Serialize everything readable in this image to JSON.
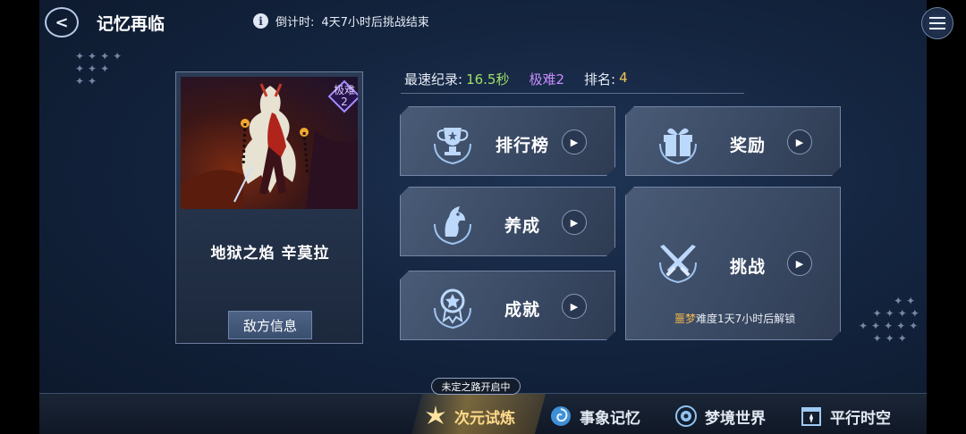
{
  "header": {
    "title": "记忆再临",
    "countdown_label": "倒计时:",
    "countdown_text": "4天7小时后挑战结束"
  },
  "boss": {
    "name": "地狱之焰 辛莫拉",
    "difficulty_badge_top": "极难",
    "difficulty_badge_bottom": "2",
    "enemy_info_label": "敌方信息"
  },
  "record": {
    "best_label": "最速纪录:",
    "best_time": "16.5秒",
    "difficulty": "极难2",
    "rank_label": "排名:",
    "rank_value": "4"
  },
  "actions": {
    "leaderboard": "排行榜",
    "rewards": "奖励",
    "cultivate": "养成",
    "challenge": "挑战",
    "achievements": "成就",
    "challenge_lock_highlight": "噩梦",
    "challenge_lock_text": "难度1天7小时后解锁"
  },
  "bottom_nav": {
    "event_tag": "未定之路开启中",
    "tabs": [
      {
        "label": "次元试炼",
        "icon": "star-burst-icon",
        "active": true
      },
      {
        "label": "事象记忆",
        "icon": "spiral-icon",
        "active": false
      },
      {
        "label": "梦境世界",
        "icon": "dream-orb-icon",
        "active": false
      },
      {
        "label": "平行时空",
        "icon": "parallel-gate-icon",
        "active": false
      }
    ]
  },
  "colors": {
    "record_time": "#9fe06a",
    "record_difficulty": "#c98cff",
    "rank": "#f3c456",
    "lock_highlight": "#f2b84b",
    "active_tab": "#ffd98a"
  }
}
